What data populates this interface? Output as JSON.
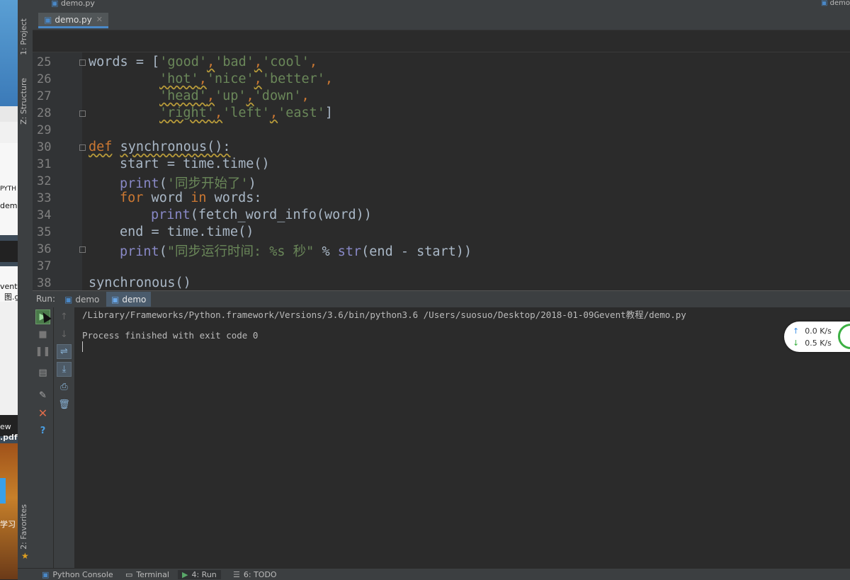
{
  "desktop": {
    "texts": [
      "PYTH",
      "demo",
      "vent教",
      "图.g",
      "ew",
      ".pdf",
      "学习"
    ]
  },
  "breadcrumb": {
    "file": "demo.py",
    "right": "demo"
  },
  "tool_windows": {
    "project": "1: Project",
    "structure": "Z: Structure",
    "favorites": "2: Favorites"
  },
  "editor": {
    "tab": "demo.py",
    "line_numbers": [
      "25",
      "26",
      "27",
      "28",
      "29",
      "30",
      "31",
      "32",
      "33",
      "34",
      "35",
      "36",
      "37",
      "38"
    ],
    "lines": {
      "l25": {
        "a": "words = [",
        "s1": "'good'",
        "c1": ",",
        "s2": "'bad'",
        "c2": ",",
        "s3": "'cool'",
        "c3": ","
      },
      "l26": {
        "s1": "'hot'",
        "c1": ",",
        "s2": "'nice'",
        "c2": ",",
        "s3": "'better'",
        "c3": ","
      },
      "l27": {
        "s1": "'head'",
        "c1": ",",
        "s2": "'up'",
        "c2": ",",
        "s3": "'down'",
        "c3": ","
      },
      "l28": {
        "s1": "'right'",
        "c1": ",",
        "s2": "'left'",
        "c2": ",",
        "s3": "'east'",
        "c3": "]"
      },
      "l30": {
        "kw": "def",
        "name": "synchronous():"
      },
      "l31": {
        "text": "start = time.time()"
      },
      "l32": {
        "bi": "print",
        "p1": "(",
        "str": "'同步开始了'",
        "p2": ")"
      },
      "l33": {
        "kw1": "for",
        "t1": " word ",
        "kw2": "in",
        "t2": " words:"
      },
      "l34": {
        "bi": "print",
        "rest": "(fetch_word_info(word))"
      },
      "l35": {
        "text": "end = time.time()"
      },
      "l36": {
        "bi": "print",
        "p1": "(",
        "str": "\"同步运行时间: %s 秒\"",
        "mid": " % ",
        "bi2": "str",
        "rest": "(end - start))"
      },
      "l38": {
        "text": "synchronous()"
      }
    }
  },
  "run": {
    "label": "Run:",
    "tabs": [
      "demo",
      "demo"
    ],
    "console_lines": [
      "/Library/Frameworks/Python.framework/Versions/3.6/bin/python3.6 /Users/suosuo/Desktop/2018-01-09Gevent教程/demo.py",
      "",
      "Process finished with exit code 0"
    ]
  },
  "network": {
    "up": "0.0 K/s",
    "down": "0.5 K/s"
  },
  "bottom_tabs": [
    "Python Console",
    "Terminal",
    "4: Run",
    "6: TODO"
  ],
  "colors": {
    "keyword": "#cc7832",
    "string": "#6a8759",
    "builtin": "#8888c6",
    "text": "#a9b7c6",
    "accent": "#4a88c7"
  }
}
